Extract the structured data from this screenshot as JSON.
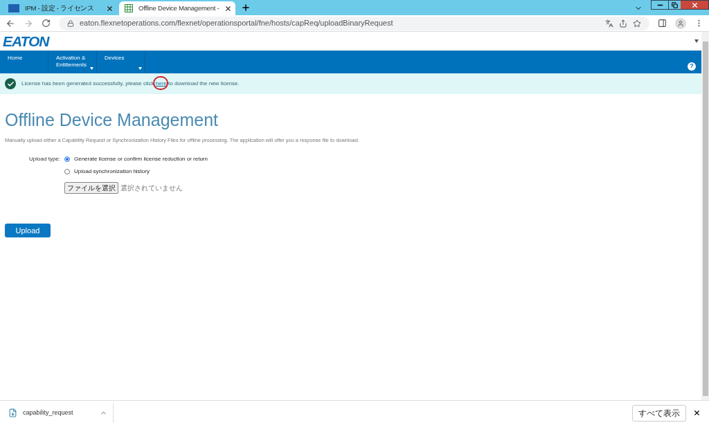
{
  "browser": {
    "tabs": [
      {
        "title": "IPM - 設定 - ライセンス",
        "selected": false
      },
      {
        "title": "Offline Device Management -",
        "selected": true
      }
    ],
    "url": "eaton.flexnetoperations.com/flexnet/operationsportal/fne/hosts/capReq/uploadBinaryRequest"
  },
  "logo": "EATON",
  "nav": [
    {
      "label": "Home",
      "dropdown": false
    },
    {
      "label": "Activation & Entitlements",
      "dropdown": true
    },
    {
      "label": "Devices",
      "dropdown": true
    }
  ],
  "help": "?",
  "banner": {
    "before": "License has been generated successfully, please click ",
    "link": "here",
    "after": " to download the new license.",
    "link_circled": true
  },
  "title": "Offline Device Management",
  "description": "Manually upload either a Capability Request or Synchronization History Files for offline processing. The application will offer you a response file to download.",
  "upload_type": {
    "label": "Upload type:",
    "options": [
      {
        "label": "Generate license or confirm license reduction or return",
        "selected": true
      },
      {
        "label": "Upload synchronization history",
        "selected": false
      }
    ]
  },
  "file": {
    "button": "ファイルを選択",
    "status": "選択されていません"
  },
  "upload_button": "Upload",
  "downloads": {
    "file": "capability_request",
    "show_all": "すべて表示"
  }
}
